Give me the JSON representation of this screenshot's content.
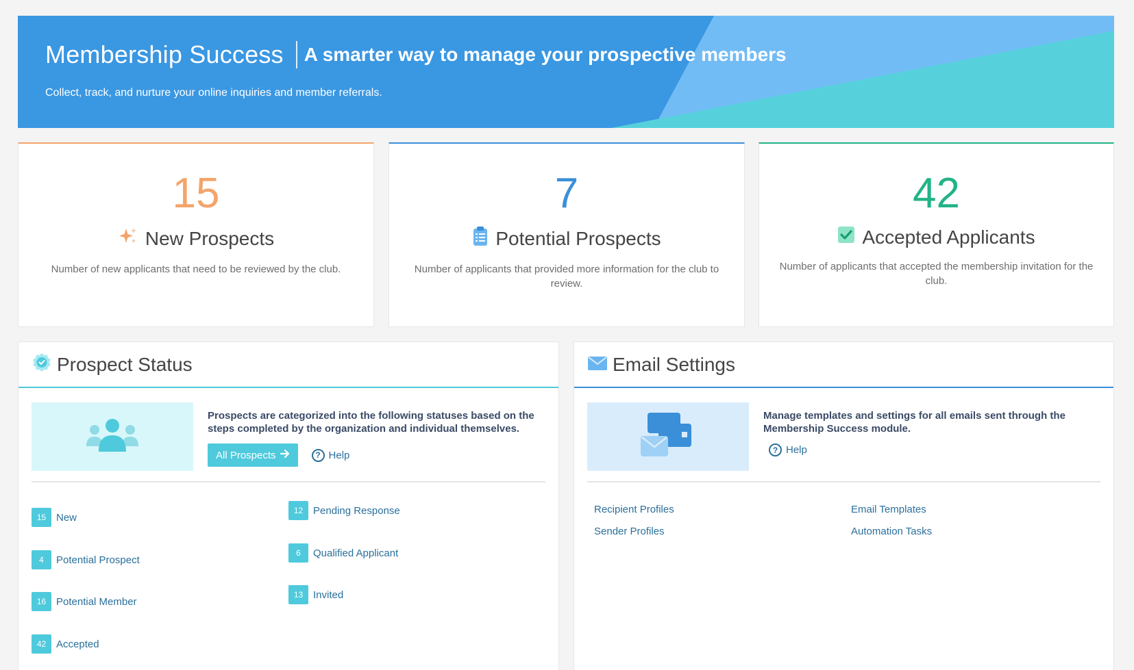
{
  "banner": {
    "app_title": "Membership Success",
    "tagline": "A smarter way to manage your prospective members",
    "subtitle": "Collect, track, and nurture your online inquiries and member referrals."
  },
  "stats": {
    "new": {
      "number": "15",
      "title": "New Prospects",
      "description": "Number of new applicants that need to be reviewed by the club.",
      "icon": "sparkle-icon",
      "color": "#f4a46a"
    },
    "potential": {
      "number": "7",
      "title": "Potential Prospects",
      "description": "Number of applicants that provided more information for the club to review.",
      "icon": "clipboard-icon",
      "color": "#3a8fd8"
    },
    "accepted": {
      "number": "42",
      "title": "Accepted Applicants",
      "description": "Number of applicants that accepted the membership invitation for the club.",
      "icon": "checkbox-icon",
      "color": "#22b387"
    }
  },
  "prospect_status": {
    "title": "Prospect Status",
    "intro": "Prospects are categorized into the following statuses based on the steps completed by the organization and individual themselves.",
    "all_button": "All Prospects",
    "help": "Help",
    "statuses": [
      {
        "count": "15",
        "label": "New"
      },
      {
        "count": "4",
        "label": "Potential Prospect"
      },
      {
        "count": "16",
        "label": "Potential Member"
      },
      {
        "count": "42",
        "label": "Accepted"
      },
      {
        "count": "12",
        "label": "Pending Response"
      },
      {
        "count": "6",
        "label": "Qualified Applicant"
      },
      {
        "count": "13",
        "label": "Invited"
      }
    ]
  },
  "email_settings": {
    "title": "Email Settings",
    "intro": "Manage templates and settings for all emails sent through the Membership Success module.",
    "help": "Help",
    "links": [
      "Recipient Profiles",
      "Sender Profiles",
      "Email Templates",
      "Automation Tasks"
    ]
  },
  "colors": {
    "banner": "#3a97e2",
    "teal": "#4ecadc",
    "link": "#2a6f9b"
  }
}
